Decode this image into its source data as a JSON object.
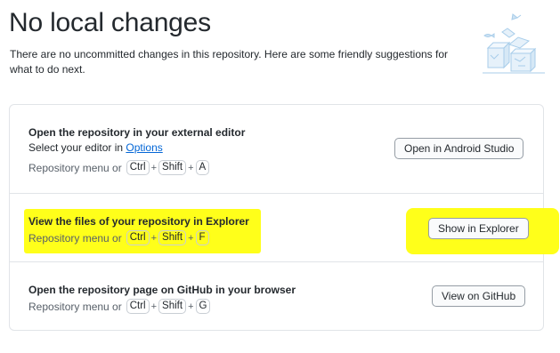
{
  "header": {
    "title": "No local changes",
    "subtitle": "There are no uncommitted changes in this repository. Here are some friendly suggestions for what to do next."
  },
  "actions": [
    {
      "title": "Open the repository in your external editor",
      "description_prefix": "Select your editor in ",
      "description_link": "Options",
      "shortcut_prefix": "Repository menu or",
      "keys": [
        "Ctrl",
        "Shift",
        "A"
      ],
      "button_label": "Open in Android Studio"
    },
    {
      "title": "View the files of your repository in Explorer",
      "shortcut_prefix": "Repository menu or",
      "keys": [
        "Ctrl",
        "Shift",
        "F"
      ],
      "button_label": "Show in Explorer"
    },
    {
      "title": "Open the repository page on GitHub in your browser",
      "shortcut_prefix": "Repository menu or",
      "keys": [
        "Ctrl",
        "Shift",
        "G"
      ],
      "button_label": "View on GitHub"
    }
  ],
  "colors": {
    "highlight": "#ffff1a",
    "link": "#0366d6",
    "border": "#e1e4e8",
    "illustration": "#a8cdea"
  },
  "illustration_icon": "empty-repo-illustration"
}
